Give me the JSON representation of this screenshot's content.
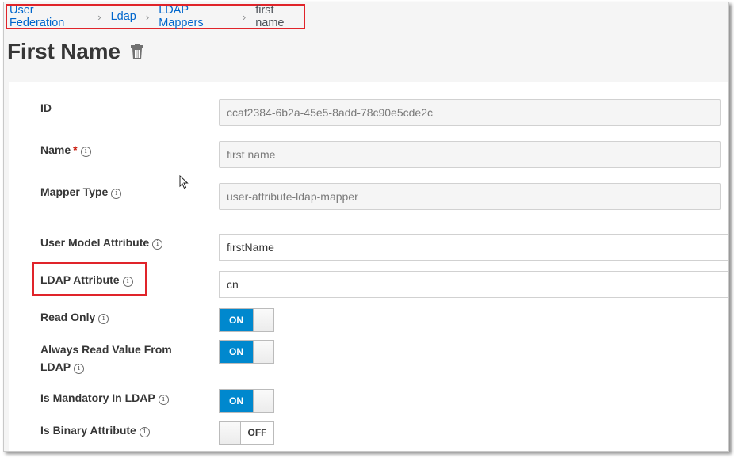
{
  "breadcrumb": {
    "items": [
      "User Federation",
      "Ldap",
      "LDAP Mappers"
    ],
    "current": "first name",
    "separator": "›"
  },
  "page": {
    "title": "First Name",
    "delete_icon": "trash-icon"
  },
  "form": {
    "id": {
      "label": "ID",
      "value": "ccaf2384-6b2a-45e5-8add-78c90e5cde2c"
    },
    "name": {
      "label": "Name",
      "required_mark": "*",
      "value": "first name"
    },
    "mapper_type": {
      "label": "Mapper Type",
      "value": "user-attribute-ldap-mapper"
    },
    "user_model_attribute": {
      "label": "User Model Attribute",
      "value": "firstName"
    },
    "ldap_attribute": {
      "label": "LDAP Attribute",
      "value": "cn"
    },
    "read_only": {
      "label": "Read Only",
      "state": "ON"
    },
    "always_read": {
      "label_line1": "Always Read Value From",
      "label_line2": "LDAP",
      "state": "ON"
    },
    "is_mandatory": {
      "label": "Is Mandatory In LDAP",
      "state": "ON"
    },
    "is_binary": {
      "label": "Is Binary Attribute",
      "state": "OFF"
    }
  },
  "info_glyph": "i",
  "colors": {
    "link": "#0066cc",
    "toggle_on": "#0088ce",
    "highlight": "#e0242a"
  }
}
